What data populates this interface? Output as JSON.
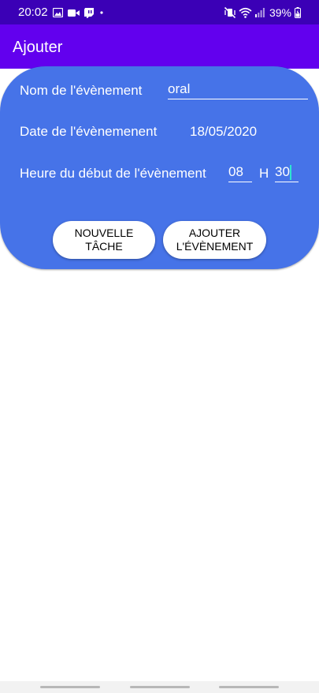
{
  "status_bar": {
    "time": "20:02",
    "battery": "39%",
    "icons": [
      "image-icon",
      "video-camera-icon",
      "twitch-icon",
      "dot-icon",
      "mute-vibrate-icon",
      "wifi-icon",
      "signal-icon",
      "battery-charging-icon"
    ]
  },
  "app_bar": {
    "title": "Ajouter"
  },
  "form": {
    "name_label": "Nom de l'évènement",
    "name_value": "oral",
    "date_label": "Date de l'évènemenent",
    "date_value": "18/05/2020",
    "time_label": "Heure du début de l'évènement",
    "hour_value": "08",
    "hour_separator": "H",
    "minute_value": "30"
  },
  "buttons": {
    "new_task": "NOUVELLE TÂCHE",
    "add_event_line1": "AJOUTER",
    "add_event_line2": "L'ÉVÈNEMENT"
  },
  "colors": {
    "status_bar": "#3b00b6",
    "app_bar": "#6200ee",
    "card": "#4673e8",
    "cursor": "#2ee6d0"
  }
}
